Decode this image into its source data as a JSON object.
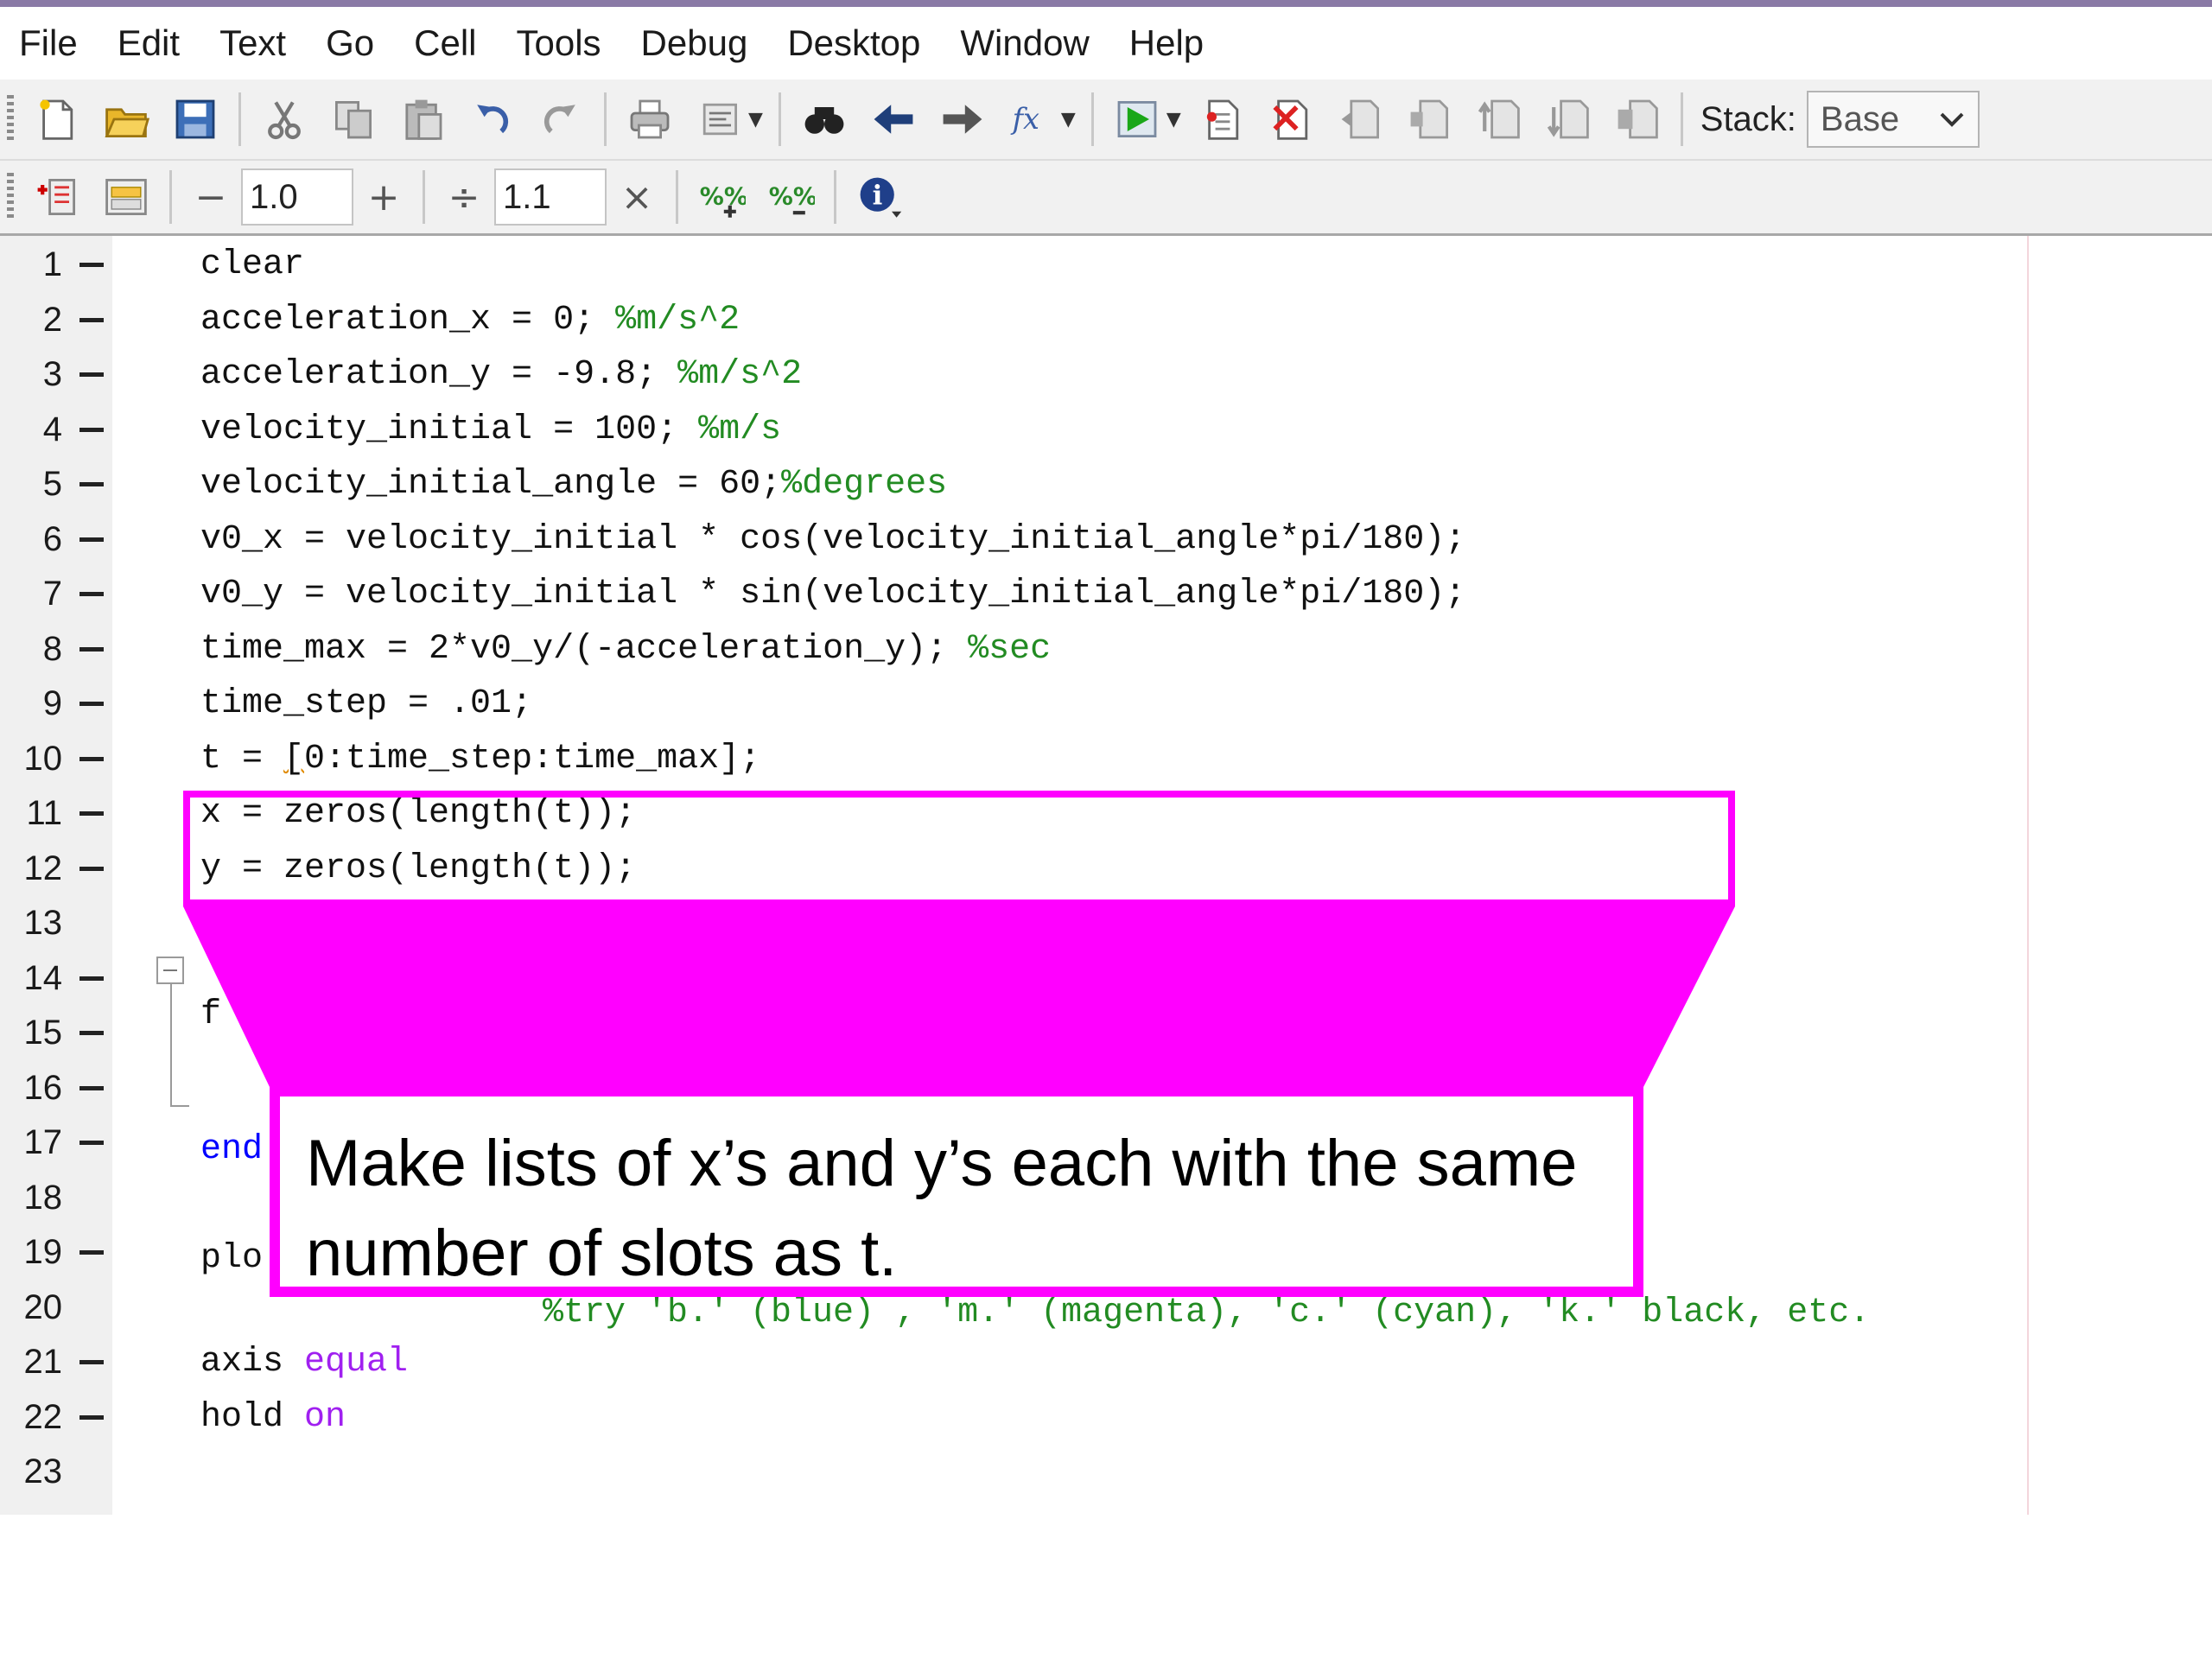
{
  "menu": [
    "File",
    "Edit",
    "Text",
    "Go",
    "Cell",
    "Tools",
    "Debug",
    "Desktop",
    "Window",
    "Help"
  ],
  "toolbar": {
    "stack_label": "Stack:",
    "stack_value": "Base",
    "icons": [
      "new-file-icon",
      "open-folder-icon",
      "save-icon",
      "cut-icon",
      "copy-icon",
      "paste-icon",
      "undo-icon",
      "redo-icon",
      "print-icon",
      "format-icon",
      "find-icon",
      "back-arrow-icon",
      "forward-arrow-icon",
      "function-icon",
      "run-icon",
      "set-breakpoint-icon",
      "clear-breakpoint-icon",
      "step-icon",
      "step-in-icon",
      "step-out-icon",
      "continue-icon",
      "exit-debug-icon"
    ]
  },
  "cell_toolbar": {
    "decrement_label": "−",
    "field1_value": "1.0",
    "increment_label": "+",
    "divide_label": "÷",
    "field2_value": "1.1",
    "multiply_label": "×"
  },
  "editor": {
    "lines": [
      {
        "n": "1",
        "segs": [
          {
            "t": "clear",
            "c": ""
          }
        ]
      },
      {
        "n": "2",
        "segs": [
          {
            "t": "acceleration_x = 0; ",
            "c": ""
          },
          {
            "t": "%m/s^2",
            "c": "cm"
          }
        ]
      },
      {
        "n": "3",
        "segs": [
          {
            "t": "acceleration_y = -9.8; ",
            "c": ""
          },
          {
            "t": "%m/s^2",
            "c": "cm"
          }
        ]
      },
      {
        "n": "4",
        "segs": [
          {
            "t": "velocity_initial = 100; ",
            "c": ""
          },
          {
            "t": "%m/s",
            "c": "cm"
          }
        ]
      },
      {
        "n": "5",
        "segs": [
          {
            "t": "velocity_initial_angle = 60;",
            "c": ""
          },
          {
            "t": "%degrees",
            "c": "cm"
          }
        ]
      },
      {
        "n": "6",
        "segs": [
          {
            "t": "v0_x = velocity_initial * cos(velocity_initial_angle*pi/180);",
            "c": ""
          }
        ]
      },
      {
        "n": "7",
        "segs": [
          {
            "t": "v0_y = velocity_initial * sin(velocity_initial_angle*pi/180);",
            "c": ""
          }
        ]
      },
      {
        "n": "8",
        "segs": [
          {
            "t": "time_max = 2*v0_y/(-acceleration_y); ",
            "c": ""
          },
          {
            "t": "%sec",
            "c": "cm"
          }
        ]
      },
      {
        "n": "9",
        "segs": [
          {
            "t": "time_step = .01;",
            "c": ""
          }
        ]
      },
      {
        "n": "10",
        "segs": [
          {
            "t": "t = ",
            "c": ""
          },
          {
            "t": "[",
            "c": "wavy"
          },
          {
            "t": "0:time_step:time_max];",
            "c": ""
          }
        ]
      },
      {
        "n": "11",
        "segs": [
          {
            "t": "x = zeros(length(t));",
            "c": ""
          }
        ]
      },
      {
        "n": "12",
        "segs": [
          {
            "t": "y = zeros(length(t));",
            "c": ""
          }
        ]
      },
      {
        "n": "13",
        "segs": []
      },
      {
        "n": "14",
        "segs": []
      },
      {
        "n": "15",
        "segs": []
      },
      {
        "n": "16",
        "segs": []
      },
      {
        "n": "17",
        "segs": []
      },
      {
        "n": "18",
        "segs": []
      },
      {
        "n": "19",
        "segs": []
      },
      {
        "n": "20",
        "segs": []
      },
      {
        "n": "21",
        "segs": [
          {
            "t": "axis ",
            "c": ""
          },
          {
            "t": "equal",
            "c": "str"
          }
        ]
      },
      {
        "n": "22",
        "segs": [
          {
            "t": "hold ",
            "c": ""
          },
          {
            "t": "on",
            "c": "str"
          }
        ]
      },
      {
        "n": "23",
        "segs": []
      }
    ],
    "partials": {
      "line14": "f",
      "line17": "end",
      "line19": "plo",
      "line20": "%try 'b.' (blue) , 'm.' (magenta), 'c.' (cyan), 'k.' black, etc."
    },
    "breakpoint_lines": [
      "1",
      "2",
      "3",
      "4",
      "5",
      "6",
      "7",
      "8",
      "9",
      "10",
      "11",
      "12",
      "14",
      "15",
      "16",
      "17",
      "19",
      "21",
      "22"
    ]
  },
  "annotation": {
    "text": "Make lists of x’s and y’s each with the same number of slots as t.",
    "color": "#ff00ff"
  }
}
